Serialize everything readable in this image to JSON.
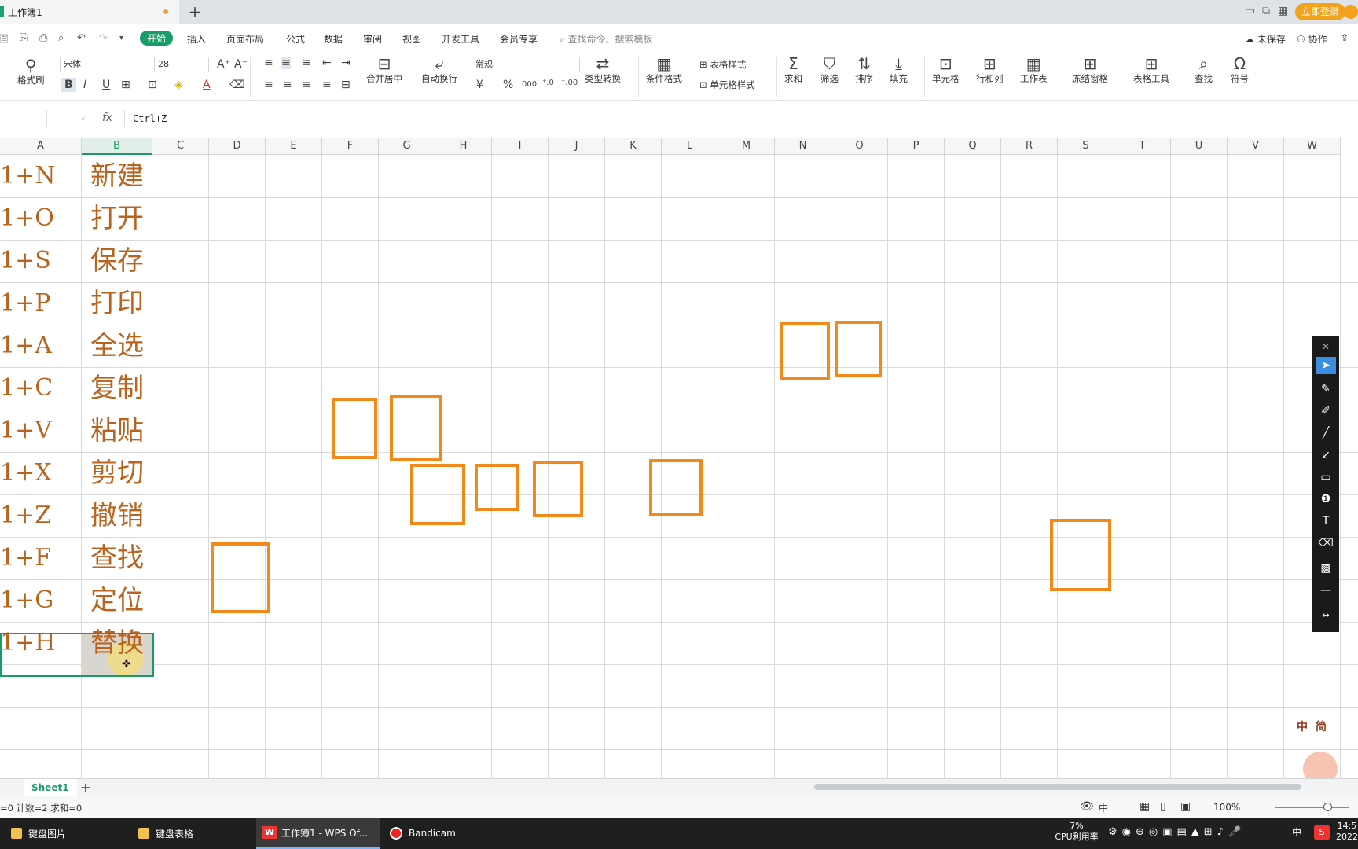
{
  "titlebar": {
    "doc_name": "工作簿1",
    "new_tab": "+",
    "login": "立即登录"
  },
  "menu": {
    "tabs": [
      "开始",
      "插入",
      "页面布局",
      "公式",
      "数据",
      "审阅",
      "视图",
      "开发工具",
      "会员专享"
    ],
    "search_placeholder": "查找命令、搜索模板",
    "unsaved": "未保存",
    "collab": "协作"
  },
  "ribbon": {
    "format_painter": "格式刷",
    "font_name": "宋体",
    "font_size": "28",
    "merge_center": "合并居中",
    "auto_wrap": "自动换行",
    "number_format": "常规",
    "type_convert": "类型转换",
    "cond_format": "条件格式",
    "table_style": "表格样式",
    "cell_style": "单元格样式",
    "sum": "求和",
    "filter": "筛选",
    "sort": "排序",
    "fill": "填充",
    "cell": "单元格",
    "row_col": "行和列",
    "worksheet": "工作表",
    "freeze": "冻结窗格",
    "table_tools": "表格工具",
    "find": "查找",
    "symbol": "符号",
    "bold": "B",
    "italic": "I",
    "underline": "U",
    "currency": "¥",
    "percent": "%",
    "thousands": "000"
  },
  "formula_bar": {
    "fx": "fx",
    "content": "Ctrl+Z"
  },
  "columns": [
    "A",
    "B",
    "C",
    "D",
    "E",
    "F",
    "G",
    "H",
    "I",
    "J",
    "K",
    "L",
    "M",
    "N",
    "O",
    "P",
    "Q",
    "R",
    "S",
    "T",
    "U",
    "V",
    "W"
  ],
  "rows": [
    {
      "a": "1+N",
      "b": "新建"
    },
    {
      "a": "1+O",
      "b": "打开"
    },
    {
      "a": "1+S",
      "b": "保存"
    },
    {
      "a": "1+P",
      "b": "打印"
    },
    {
      "a": "1+A",
      "b": "全选"
    },
    {
      "a": "1+C",
      "b": "复制"
    },
    {
      "a": "1+V",
      "b": "粘贴"
    },
    {
      "a": "1+X",
      "b": "剪切"
    },
    {
      "a": "1+Z",
      "b": "撤销"
    },
    {
      "a": "1+F",
      "b": "查找"
    },
    {
      "a": "1+G",
      "b": "定位"
    },
    {
      "a": "1+H",
      "b": "替换"
    }
  ],
  "sheet": {
    "tab": "Sheet1",
    "add": "+"
  },
  "status": {
    "text": "=0  计数=2  求和=0",
    "zoom": "100%",
    "input_mode": "中"
  },
  "taskbar": {
    "items": [
      "键盘图片",
      "键盘表格",
      "工作簿1 - WPS Of...",
      "Bandicam"
    ],
    "cpu_percent": "7%",
    "cpu_label": "CPU利用率",
    "ime": "中",
    "time": "14:5",
    "date": "2022"
  },
  "mascot": {
    "labels": [
      "中",
      "简"
    ]
  }
}
